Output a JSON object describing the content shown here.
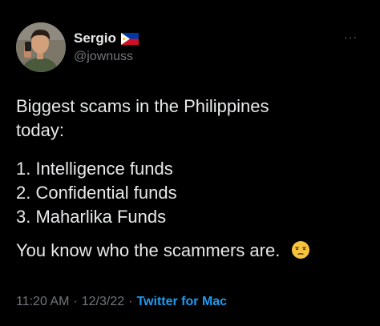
{
  "author": {
    "name": "Sergio",
    "flag_icon": "philippines-flag-icon",
    "handle": "@jownuss"
  },
  "more_menu": {
    "label": "···",
    "icon": "more-dots-icon"
  },
  "tweet": {
    "intro_line1": "Biggest scams in the Philippines",
    "intro_line2": "today:",
    "items": [
      "1. Intelligence funds",
      "2. Confidential funds",
      "3. Maharlika Funds"
    ],
    "closing": "You know who the scammers are.",
    "closing_emoji": "unamused-face-emoji"
  },
  "meta": {
    "time": "11:20 AM",
    "separator": "·",
    "date": "12/3/22",
    "source": "Twitter for Mac"
  },
  "colors": {
    "background": "#000000",
    "text": "#e7e9ea",
    "secondary": "#71767b",
    "link": "#1d9bf0"
  }
}
